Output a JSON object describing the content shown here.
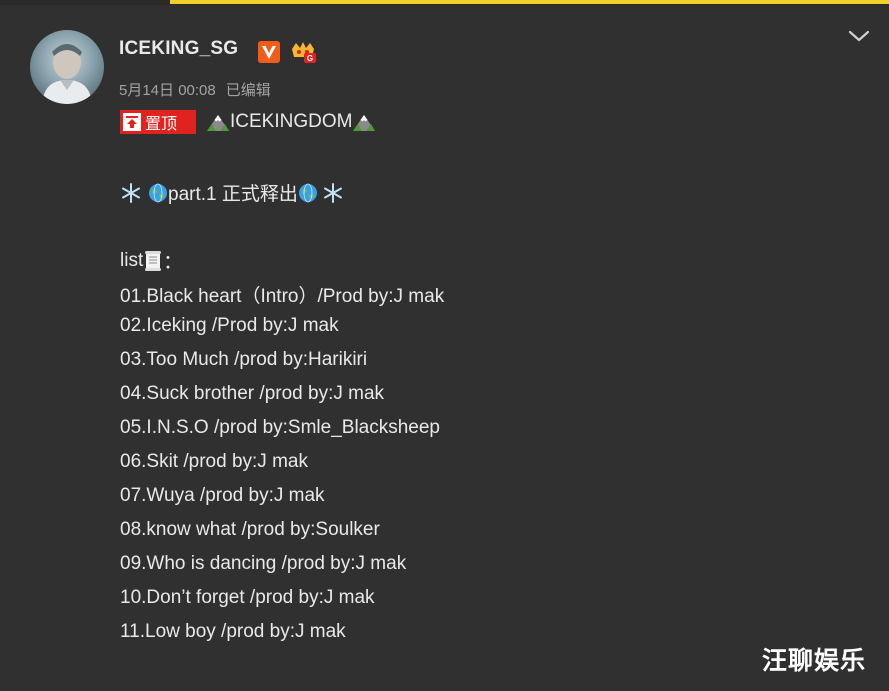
{
  "post": {
    "username": "ICEKING_SG",
    "date": "5月14日 00:08",
    "edited": "已编辑",
    "pin_label": "置顶",
    "title_text": "ICEKINGDOM",
    "release_text": "part.1 正式释出",
    "list_label": "list",
    "list_colon": "：",
    "tracks": [
      "01.Black heart（Intro）/Prod by:J mak",
      "02.Iceking /Prod by:J mak",
      "03.Too Much /prod by:Harikiri",
      "04.Suck brother /prod by:J mak",
      "05.I.N.S.O /prod by:Smle_Blacksheep",
      "06.Skit /prod by:J mak",
      "07.Wuya /prod by:J mak",
      "08.know what /prod by:Soulker",
      "09.Who is dancing /prod by:J mak",
      "10.Don’t forget /prod by:J mak",
      "11.Low boy /prod by:J mak"
    ]
  },
  "icons": {
    "verified": "v-badge-icon",
    "fan": "fan-badge-icon",
    "more": "chevron-down-icon",
    "mountain": "mountain-icon",
    "snow": "snowflake-icon",
    "globe": "globe-icon",
    "scroll": "scroll-icon"
  },
  "colors": {
    "background": "#303030",
    "pin_red": "#e0231e",
    "verified_orange": "#f25c1b",
    "top_bar_yellow": "#f2cf2a"
  },
  "watermark": "汪聊娱乐"
}
